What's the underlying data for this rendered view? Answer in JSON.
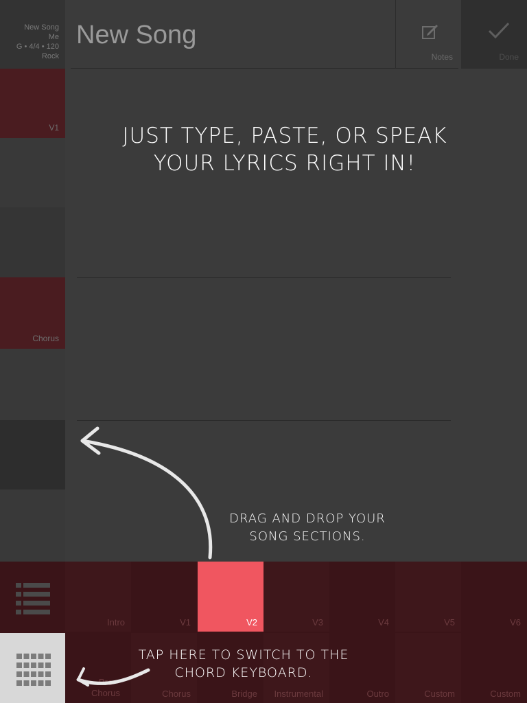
{
  "sidebar": {
    "song_info": {
      "title": "New Song",
      "author": "Me",
      "meta": "G • 4/4 • 120",
      "genre": "Rock"
    },
    "sections": [
      {
        "label": "V1",
        "color": "#4a1c20"
      },
      {
        "label": "",
        "color": "#393939"
      },
      {
        "label": "",
        "color": "#353535"
      },
      {
        "label": "Chorus",
        "color": "#4a1c20"
      },
      {
        "label": "",
        "color": "#393939"
      },
      {
        "label": "",
        "color": "#2d2d2d"
      },
      {
        "label": "",
        "color": "#393939"
      }
    ]
  },
  "header": {
    "title": "New Song",
    "notes_label": "Notes",
    "done_label": "Done"
  },
  "annotations": {
    "lyrics": "Just type, paste, or speak your lyrics right in!",
    "drag": "Drag and drop your song sections.",
    "tap": "Tap here to switch to the chord keyboard."
  },
  "palette": {
    "row1": [
      "Intro",
      "V1",
      "V2",
      "V3",
      "V4",
      "V5",
      "V6"
    ],
    "row2": [
      "Pre Chorus",
      "Chorus",
      "Bridge",
      "Instrumental",
      "Outro",
      "Custom",
      "Custom"
    ],
    "active": "V2",
    "colors": {
      "tile": "#3a1418",
      "tile_alt": "#3e171b",
      "active": "#f05660"
    }
  },
  "icons": {
    "notes": "compose-icon",
    "done": "checkmark-icon",
    "list": "list-icon",
    "keyboard": "grid-keypad-icon",
    "arrow_up": "curved-arrow-icon",
    "arrow_left": "curved-arrow-icon"
  }
}
